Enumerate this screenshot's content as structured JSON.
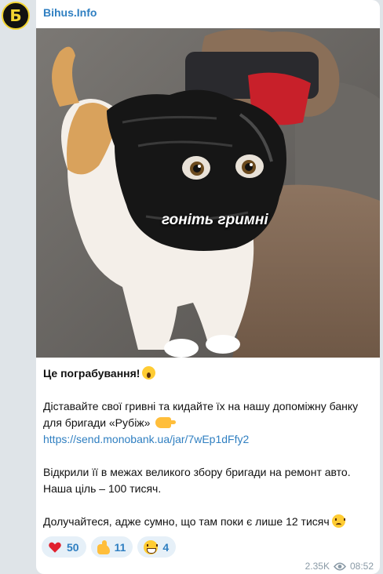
{
  "channel": {
    "name": "Bihus.Info",
    "avatar_letter": "Б"
  },
  "photo": {
    "overlay_text": "гоніть гримні"
  },
  "post": {
    "title": "Це пограбування!",
    "title_emoji": "screaming-face-icon",
    "paragraph1": "Діставайте свої гривні та кидайте їх на нашу допоміжну банку для бригади «Рубіж»",
    "paragraph1_emoji": "pointing-hand-icon",
    "link": "https://send.monobank.ua/jar/7wEp1dFfy2",
    "paragraph2": "Відкрили її в межах великого збору бригади на ремонт авто. Наша ціль – 100 тисяч.",
    "paragraph3": "Долучайтеся, адже сумно, що там поки є лише 12 тисяч",
    "paragraph3_emoji": "sad-face-icon"
  },
  "reactions": [
    {
      "icon": "heart-icon",
      "count": "50"
    },
    {
      "icon": "thumbs-up-icon",
      "count": "11"
    },
    {
      "icon": "grinning-face-icon",
      "count": "4"
    }
  ],
  "meta": {
    "views": "2.35K",
    "time": "08:52"
  },
  "colors": {
    "background": "#dfe4e8",
    "accent": "#2f7fc1",
    "reaction_bg": "#e6f0f8",
    "avatar_ring": "#f2d531"
  }
}
